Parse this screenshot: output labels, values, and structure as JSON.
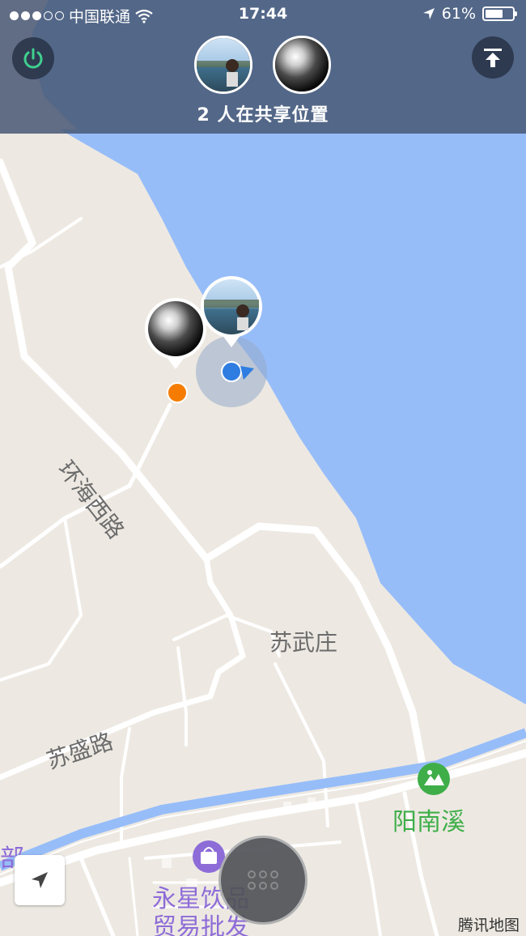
{
  "status_bar": {
    "carrier": "中国联通",
    "time": "17:44",
    "battery": "61%",
    "signal_bars_on": 3,
    "signal_bars_total": 5,
    "battery_level": 0.61
  },
  "header": {
    "share_text": "2 人在共享位置"
  },
  "map": {
    "road_labels": [
      "环海西路",
      "苏盛路"
    ],
    "place_label": "苏武庄",
    "poi_park": "阳南溪",
    "poi_shop_line1": "永星饮品",
    "poi_shop_line2": "贸易批发",
    "edge_label": "部",
    "watermark": "腾讯地图"
  },
  "colors": {
    "water": "#97bdf9",
    "land": "#ede9e2",
    "road": "#ffffff",
    "overlay": "#485876",
    "accent_green": "#3fcf8e",
    "park_green": "#3fae49",
    "poi_purple": "#8e6cd8",
    "my_location": "#2f7de1",
    "friend_pin": "#f57c00"
  },
  "icons": {
    "power": "power-icon",
    "upload": "upload-to-top-icon",
    "locate": "navigation-arrow-icon",
    "menu": "grid-dots-icon",
    "park": "park-mountain-icon",
    "shop": "shopping-bag-icon"
  }
}
